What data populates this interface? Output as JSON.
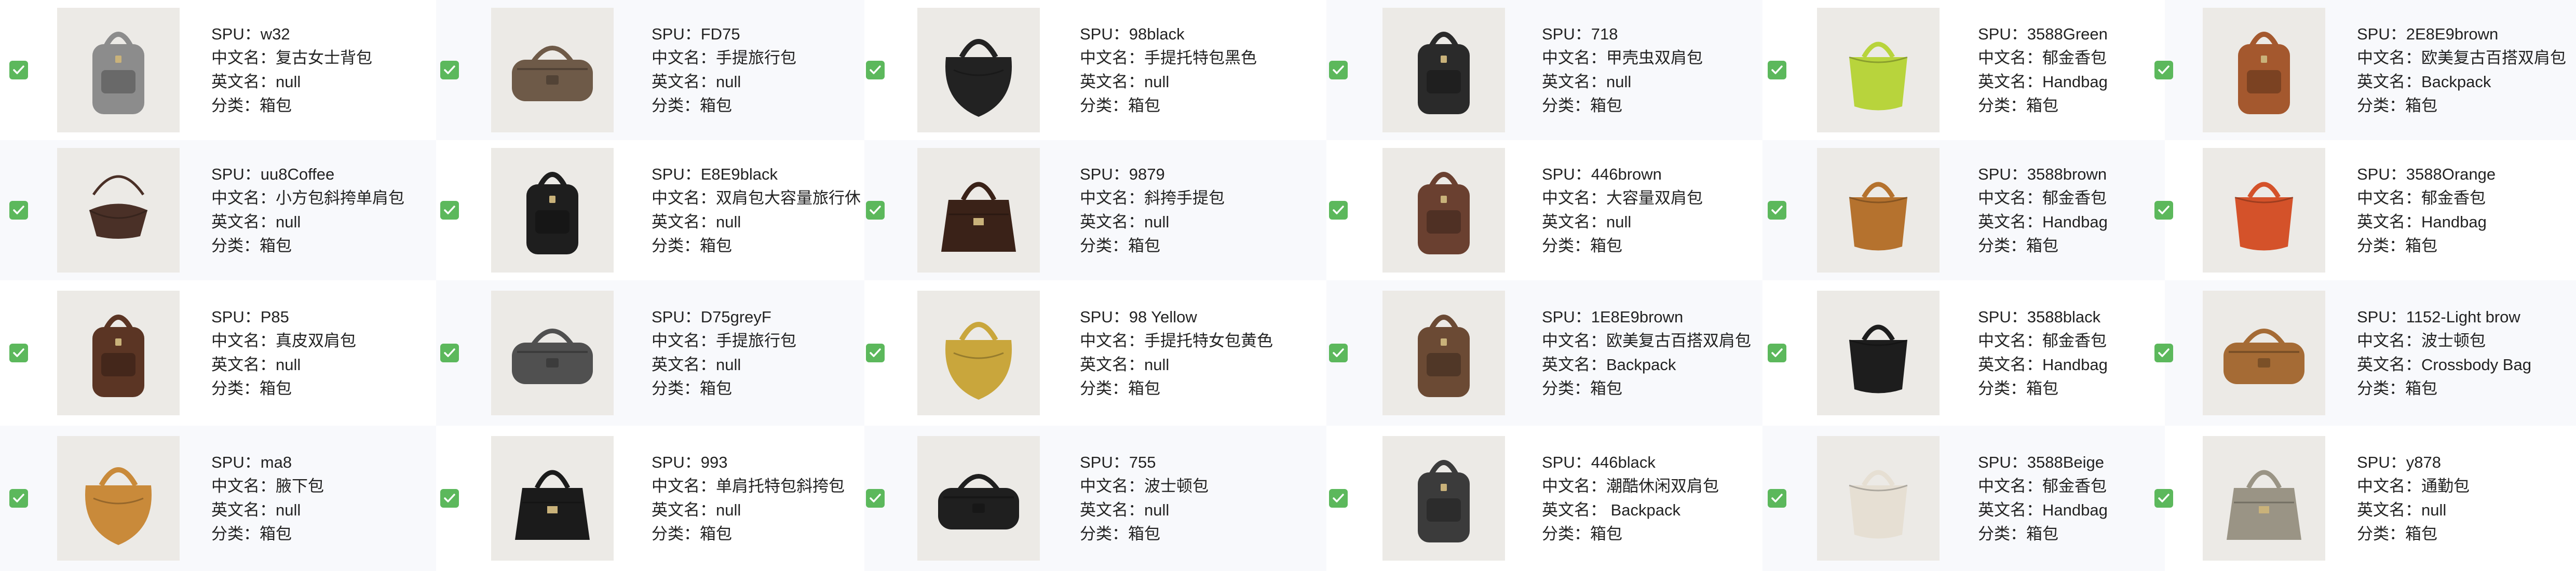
{
  "labels": {
    "spu": "SPU：",
    "cn": "中文名：",
    "en": "英文名：",
    "cat": "分类："
  },
  "colors": {
    "check": "#5cb85c",
    "alt_row": "#f8f9fc"
  },
  "columns": [
    {
      "items": [
        {
          "spu": "w32",
          "cn": "复古女士背包",
          "en": "null",
          "cat": "箱包",
          "color": "#8c8c8c",
          "shape": "backpack"
        },
        {
          "spu": "uu8Coffee",
          "cn": "小方包斜挎单肩包",
          "en": "null",
          "cat": "箱包",
          "color": "#4a3027",
          "shape": "crossbody"
        },
        {
          "spu": "P85",
          "cn": "真皮双肩包",
          "en": "null",
          "cat": "箱包",
          "color": "#5b3524",
          "shape": "backpack"
        },
        {
          "spu": "ma8",
          "cn": "腋下包",
          "en": "null",
          "cat": "箱包",
          "color": "#c98a3a",
          "shape": "hobo"
        }
      ]
    },
    {
      "items": [
        {
          "spu": "FD75",
          "cn": "手提旅行包",
          "en": "null",
          "cat": "箱包",
          "color": "#6e5a48",
          "shape": "duffel"
        },
        {
          "spu": "E8E9black",
          "cn": "双肩包大容量旅行休",
          "en": "null",
          "cat": "箱包",
          "color": "#1e1e1e",
          "shape": "backpack"
        },
        {
          "spu": "D75greyF",
          "cn": "手提旅行包",
          "en": "null",
          "cat": "箱包",
          "color": "#505050",
          "shape": "duffel"
        },
        {
          "spu": "993",
          "cn": "单肩托特包斜挎包",
          "en": "null",
          "cat": "箱包",
          "color": "#1b1b1b",
          "shape": "tote"
        }
      ]
    },
    {
      "items": [
        {
          "spu": "98black",
          "cn": "手提托特包黑色",
          "en": "null",
          "cat": "箱包",
          "color": "#222222",
          "shape": "hobo"
        },
        {
          "spu": "9879",
          "cn": "斜挎手提包",
          "en": "null",
          "cat": "箱包",
          "color": "#3a2218",
          "shape": "tote"
        },
        {
          "spu": "98 Yellow",
          "cn": "手提托特女包黄色",
          "en": "null",
          "cat": "箱包",
          "color": "#c9a63c",
          "shape": "hobo"
        },
        {
          "spu": "755",
          "cn": "波士顿包",
          "en": "null",
          "cat": "箱包",
          "color": "#1f1f1f",
          "shape": "duffel"
        }
      ]
    },
    {
      "items": [
        {
          "spu": "718",
          "cn": "甲壳虫双肩包",
          "en": "null",
          "cat": "箱包",
          "color": "#2a2a2a",
          "shape": "backpack"
        },
        {
          "spu": "446brown",
          "cn": "大容量双肩包",
          "en": "null",
          "cat": "箱包",
          "color": "#6a4030",
          "shape": "backpack"
        },
        {
          "spu": "1E8E9brown",
          "cn": "欧美复古百搭双肩包",
          "en": "Backpack",
          "cat": "箱包",
          "color": "#6b4a34",
          "shape": "backpack"
        },
        {
          "spu": "446black",
          "cn": "潮酷休闲双肩包",
          "en": " Backpack",
          "cat": "箱包",
          "color": "#3b3b3b",
          "shape": "backpack"
        }
      ]
    },
    {
      "items": [
        {
          "spu": "3588Green",
          "cn": "郁金香包",
          "en": "Handbag",
          "cat": "箱包",
          "color": "#b8d43c",
          "shape": "bucket"
        },
        {
          "spu": "3588brown",
          "cn": "郁金香包",
          "en": "Handbag",
          "cat": "箱包",
          "color": "#b5722e",
          "shape": "bucket"
        },
        {
          "spu": "3588black",
          "cn": "郁金香包",
          "en": "Handbag",
          "cat": "箱包",
          "color": "#1d1d1d",
          "shape": "bucket"
        },
        {
          "spu": "3588Beige",
          "cn": "郁金香包",
          "en": "Handbag",
          "cat": "箱包",
          "color": "#e6dfd3",
          "shape": "bucket"
        }
      ]
    },
    {
      "items": [
        {
          "spu": "2E8E9brown",
          "cn": "欧美复古百搭双肩包",
          "en": "Backpack",
          "cat": "箱包",
          "color": "#a4582e",
          "shape": "backpack"
        },
        {
          "spu": "3588Orange",
          "cn": "郁金香包",
          "en": "Handbag",
          "cat": "箱包",
          "color": "#d4522a",
          "shape": "bucket"
        },
        {
          "spu": "1152-Light brow",
          "cn": "波士顿包",
          "en": "Crossbody Bag",
          "cat": "箱包",
          "color": "#a56b35",
          "shape": "duffel"
        },
        {
          "spu": "y878",
          "cn": "通勤包",
          "en": "null",
          "cat": "箱包",
          "color": "#9a9485",
          "shape": "tote"
        }
      ]
    }
  ]
}
